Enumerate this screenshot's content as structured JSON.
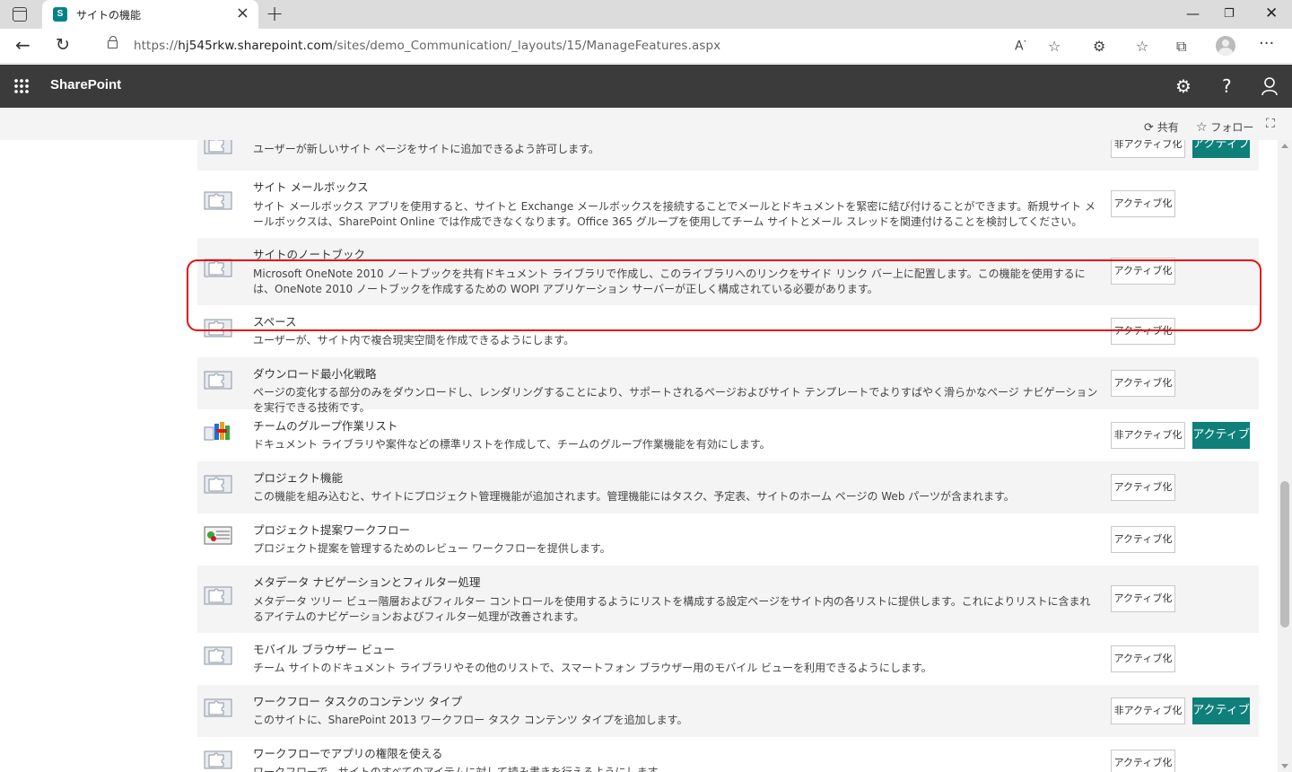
{
  "browser": {
    "tab_title": "サイトの機能",
    "url_prefix": "https://",
    "url_domain": "hj545rkw.sharepoint.com",
    "url_path": "/sites/demo_Communication/_layouts/15/ManageFeatures.aspx"
  },
  "suite": {
    "title": "SharePoint"
  },
  "commands": {
    "share": "共有",
    "follow": "フォロー"
  },
  "features": [
    {
      "name": "",
      "desc": "ユーザーが新しいサイト ページをサイトに追加できるよう許可します。",
      "status": "active",
      "icon": "puzzle"
    },
    {
      "name": "サイト メールボックス",
      "desc": "サイト メールボックス アプリを使用すると、サイトと Exchange メールボックスを接続することでメールとドキュメントを緊密に結び付けることができます。新規サイト メールボックスは、SharePoint Online では作成できなくなります。Office 365 グループを使用してチーム サイトとメール スレッドを関連付けることを検討してください。",
      "status": "inactive",
      "icon": "puzzle"
    },
    {
      "name": "サイトのノートブック",
      "desc": "Microsoft OneNote 2010 ノートブックを共有ドキュメント ライブラリで作成し、このライブラリへのリンクをサイド リンク バー上に配置します。この機能を使用するには、OneNote 2010 ノートブックを作成するための WOPI アプリケーション サーバーが正しく構成されている必要があります。",
      "status": "inactive",
      "icon": "puzzle"
    },
    {
      "name": "スペース",
      "desc": "ユーザーが、サイト内で複合現実空間を作成できるようにします。",
      "status": "inactive",
      "icon": "puzzle"
    },
    {
      "name": "ダウンロード最小化戦略",
      "desc": "ページの変化する部分のみをダウンロードし、レンダリングすることにより、サポートされるページおよびサイト テンプレートでよりすばやく滑らかなページ ナビゲーションを実行できる技術です。",
      "status": "inactive",
      "icon": "puzzle"
    },
    {
      "name": "チームのグループ作業リスト",
      "desc": "ドキュメント ライブラリや案件などの標準リストを作成して、チームのグループ作業機能を有効にします。",
      "status": "active",
      "icon": "team-collab"
    },
    {
      "name": "プロジェクト機能",
      "desc": "この機能を組み込むと、サイトにプロジェクト管理機能が追加されます。管理機能にはタスク、予定表、サイトのホーム ページの Web パーツが含まれます。",
      "status": "inactive",
      "icon": "puzzle"
    },
    {
      "name": "プロジェクト提案ワークフロー",
      "desc": "プロジェクト提案を管理するためのレビュー ワークフローを提供します。",
      "status": "inactive",
      "icon": "workflow"
    },
    {
      "name": "メタデータ ナビゲーションとフィルター処理",
      "desc": "メタデータ ツリー ビュー階層およびフィルター コントロールを使用するようにリストを構成する設定ページをサイト内の各リストに提供します。これによりリストに含まれるアイテムのナビゲーションおよびフィルター処理が改善されます。",
      "status": "inactive",
      "icon": "puzzle"
    },
    {
      "name": "モバイル ブラウザー ビュー",
      "desc": "チーム サイトのドキュメント ライブラリやその他のリストで、スマートフォン ブラウザー用のモバイル ビューを利用できるようにします。",
      "status": "inactive",
      "icon": "puzzle"
    },
    {
      "name": "ワークフロー タスクのコンテンツ タイプ",
      "desc": "このサイトに、SharePoint 2013 ワークフロー タスク コンテンツ タイプを追加します。",
      "status": "active",
      "icon": "puzzle"
    },
    {
      "name": "ワークフローでアプリの権限を使える",
      "desc": "ワークフローで、サイトのすべてのアイテムに対して読み書きを行えるようにします。",
      "status": "inactive",
      "icon": "puzzle"
    }
  ],
  "labels": {
    "activate": "アクティブ化",
    "deactivate": "非アクティブ化",
    "active": "アクティブ"
  },
  "colors": {
    "suite_bar": "#3b3b3b",
    "active_badge": "#0f7f7a",
    "highlight_border": "#e60f0f"
  }
}
